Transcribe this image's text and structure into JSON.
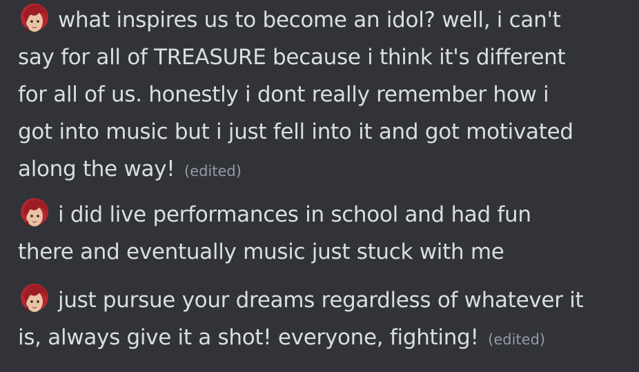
{
  "messages": [
    {
      "avatar_icon": "idol-avatar-emoji",
      "lines": [
        "what inspires us to become an idol? well, i can't",
        "say for all of TREASURE because i think it's different",
        "for all of us. honestly i dont really remember how i",
        "got into music but i just fell into it and got motivated",
        "along the way!"
      ],
      "edited_label": "(edited)"
    },
    {
      "avatar_icon": "idol-avatar-emoji",
      "lines": [
        "i did live performances in school and had fun",
        "there and eventually music just stuck with me"
      ],
      "edited_label": ""
    },
    {
      "avatar_icon": "idol-avatar-emoji",
      "lines": [
        "just pursue your dreams regardless of whatever it",
        "is, always give it a shot! everyone, fighting!"
      ],
      "edited_label": "(edited)"
    }
  ],
  "colors": {
    "background": "#313338",
    "text": "#dbdee1",
    "muted": "#949ba4",
    "hair": "#b3262e"
  }
}
